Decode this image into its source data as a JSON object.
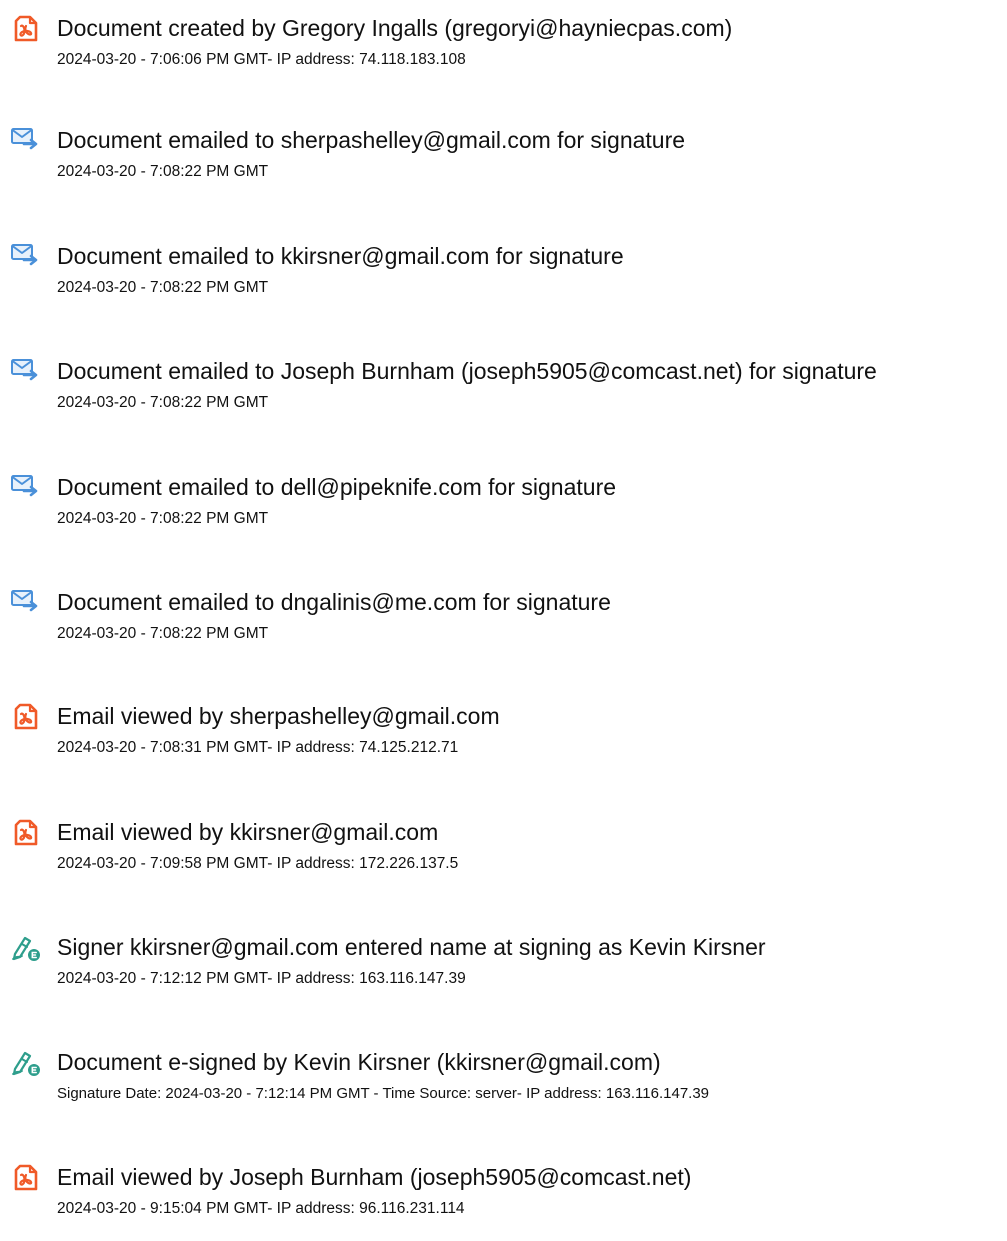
{
  "events": [
    {
      "icon": "pdf-document-icon",
      "title": "Document created by Gregory Ingalls (gregoryi@hayniecpas.com)",
      "meta": "2024-03-20 - 7:06:06 PM GMT- IP address: 74.118.183.108"
    },
    {
      "icon": "email-sent-icon",
      "title": "Document emailed to sherpashelley@gmail.com for signature",
      "meta": "2024-03-20 - 7:08:22 PM GMT"
    },
    {
      "icon": "email-sent-icon",
      "title": "Document emailed to kkirsner@gmail.com for signature",
      "meta": "2024-03-20 - 7:08:22 PM GMT"
    },
    {
      "icon": "email-sent-icon",
      "title": "Document emailed to Joseph Burnham (joseph5905@comcast.net) for signature",
      "meta": "2024-03-20 - 7:08:22 PM GMT"
    },
    {
      "icon": "email-sent-icon",
      "title": "Document emailed to dell@pipeknife.com for signature",
      "meta": "2024-03-20 - 7:08:22 PM GMT"
    },
    {
      "icon": "email-sent-icon",
      "title": "Document emailed to dngalinis@me.com for signature",
      "meta": "2024-03-20 - 7:08:22 PM GMT"
    },
    {
      "icon": "pdf-document-icon",
      "title": "Email viewed by sherpashelley@gmail.com",
      "meta": "2024-03-20 - 7:08:31 PM GMT- IP address: 74.125.212.71"
    },
    {
      "icon": "pdf-document-icon",
      "title": "Email viewed by kkirsner@gmail.com",
      "meta": "2024-03-20 - 7:09:58 PM GMT- IP address: 172.226.137.5"
    },
    {
      "icon": "e-sign-pen-icon",
      "title": "Signer kkirsner@gmail.com entered name at signing as Kevin Kirsner",
      "meta": "2024-03-20 - 7:12:12 PM GMT- IP address: 163.116.147.39"
    },
    {
      "icon": "e-sign-pen-icon",
      "title": "Document e-signed by Kevin Kirsner (kkirsner@gmail.com)",
      "meta": "Signature Date: 2024-03-20 - 7:12:14 PM GMT - Time Source: server- IP address: 163.116.147.39"
    },
    {
      "icon": "pdf-document-icon",
      "title": "Email viewed by Joseph Burnham (joseph5905@comcast.net)",
      "meta": "2024-03-20 - 9:15:04 PM GMT- IP address: 96.116.231.114"
    }
  ],
  "colors": {
    "pdf_icon": "#f05a28",
    "email_icon": "#4a90d9",
    "esign_icon": "#2e9e8c",
    "text": "#111111"
  }
}
